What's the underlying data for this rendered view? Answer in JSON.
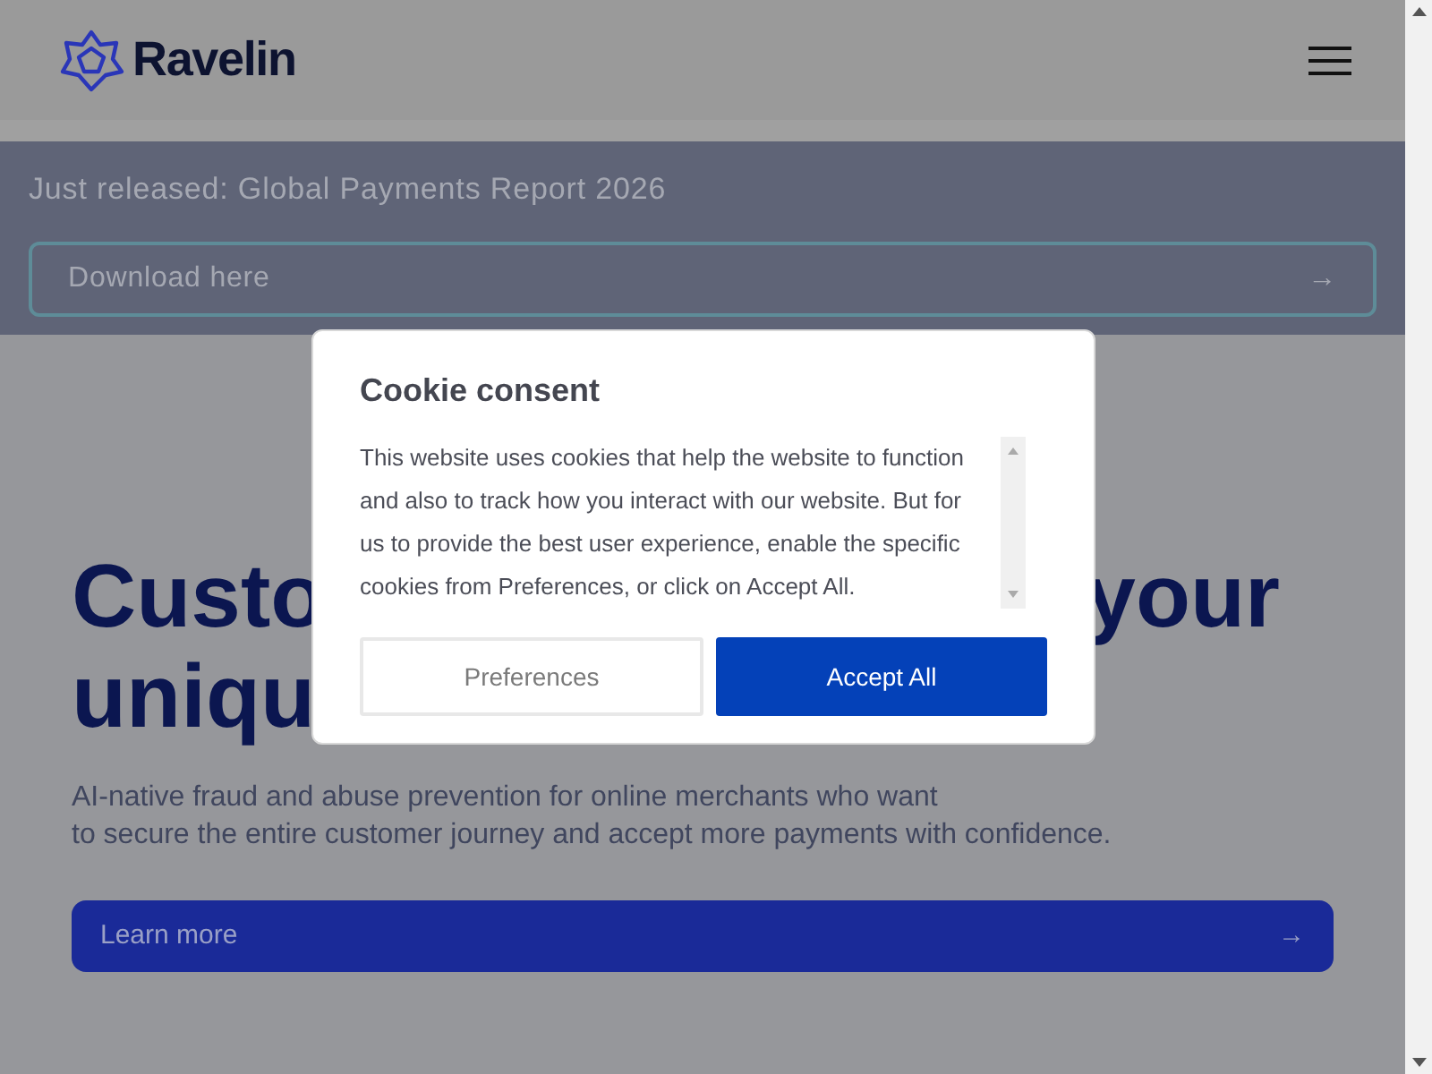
{
  "header": {
    "logo_text": "Ravelin"
  },
  "banner": {
    "title": "Just released: Global Payments Report 2026",
    "button": {
      "label": "Download here",
      "arrow": "→"
    }
  },
  "hero": {
    "headline_lines": [
      {
        "left": "Custo",
        "right": "your"
      },
      {
        "left": "uniqu"
      }
    ],
    "description": [
      "AI-native fraud and abuse prevention for online merchants who want",
      "to secure the entire customer journey and accept more payments with confidence."
    ],
    "button": {
      "label": "Learn more",
      "arrow": "→"
    }
  },
  "cookie_dialog": {
    "title": "Cookie consent",
    "body": "This website uses cookies that help the website to function and also to track how you interact with our website. But for us to provide the best user experience, enable the specific cookies from Preferences, or click on Accept All.",
    "buttons": [
      {
        "label": "Preferences",
        "kind": "secondary"
      },
      {
        "label": "Accept All",
        "kind": "primary"
      }
    ]
  }
}
